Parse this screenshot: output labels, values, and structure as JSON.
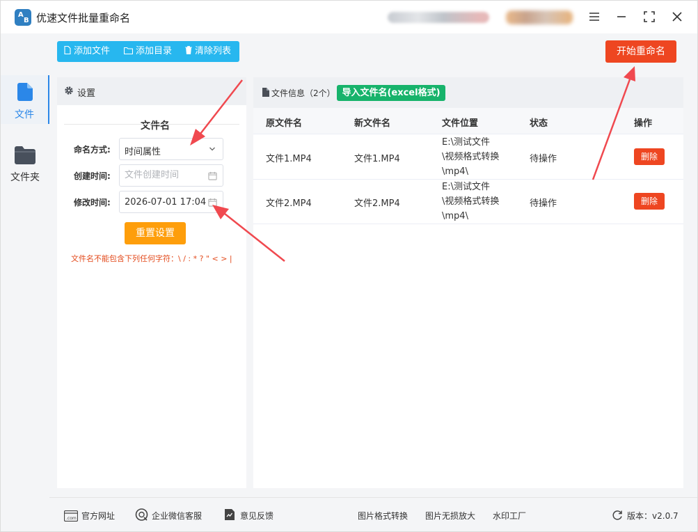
{
  "app": {
    "title": "优速文件批量重命名",
    "logo_text": [
      "A",
      "B"
    ]
  },
  "window_controls": {
    "menu": "menu-icon",
    "minimize": "minimize-icon",
    "maximize": "maximize-icon",
    "close": "close-icon"
  },
  "sidebar": {
    "items": [
      {
        "label": "文件",
        "icon": "file-icon",
        "active": true
      },
      {
        "label": "文件夹",
        "icon": "folder-icon",
        "active": false
      }
    ]
  },
  "toolbar": {
    "add_file": "添加文件",
    "add_dir": "添加目录",
    "clear_list": "清除列表",
    "start_rename": "开始重命名"
  },
  "settings": {
    "header": "设置",
    "section": "文件名",
    "naming_mode_label": "命名方式:",
    "naming_mode_value": "时间属性",
    "created_label": "创建时间:",
    "created_placeholder": "文件创建时间",
    "modified_label": "修改时间:",
    "modified_value": "2026-07-01 17:04",
    "reset": "重置设置",
    "warning": "文件名不能包含下列任何字符：\\ / : * ? \" < > |"
  },
  "files": {
    "header": "文件信息",
    "count": "（2个）",
    "import_button": "导入文件名(excel格式)",
    "columns": [
      "原文件名",
      "新文件名",
      "文件位置",
      "状态",
      "操作"
    ],
    "rows": [
      {
        "original": "文件1.MP4",
        "new": "文件1.MP4",
        "location": [
          "E:\\测试文件",
          "\\视频格式转换",
          "\\mp4\\"
        ],
        "status": "待操作",
        "action": "删除"
      },
      {
        "original": "文件2.MP4",
        "new": "文件2.MP4",
        "location": [
          "E:\\测试文件",
          "\\视频格式转换",
          "\\mp4\\"
        ],
        "status": "待操作",
        "action": "删除"
      }
    ]
  },
  "footer": {
    "website": "官方网址",
    "wechat": "企业微信客服",
    "feedback": "意见反馈",
    "image_convert": "图片格式转换",
    "image_enlarge": "图片无损放大",
    "watermark": "水印工厂",
    "version_label": "版本：",
    "version": "v2.0.7",
    "website_icon_text": ".com"
  },
  "colors": {
    "toolbar": "#27b7ef",
    "start": "#ee4621",
    "reset": "#fe9e0b",
    "import": "#17b36b",
    "delete": "#ee4621",
    "active": "#2b87e8",
    "arrow": "#f0494f"
  }
}
